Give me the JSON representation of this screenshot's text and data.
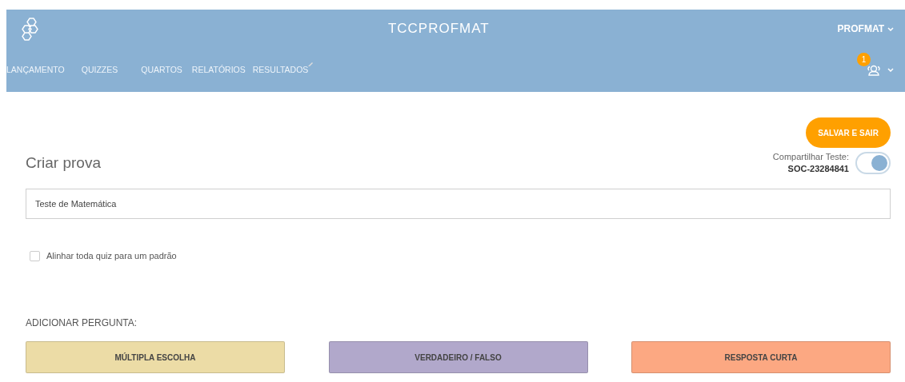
{
  "header": {
    "title": "TCCPROFMAT",
    "user_menu": "PROFMAT",
    "notification_count": "1",
    "nav": [
      {
        "label": "LANÇAMENTO",
        "selected": false
      },
      {
        "label": "QUIZZES",
        "selected": false
      },
      {
        "label": "QUARTOS",
        "selected": false
      },
      {
        "label": "RELATÓRIOS",
        "selected": false
      },
      {
        "label": "RESULTADOS",
        "selected": false
      }
    ]
  },
  "save_button": "SALVAR E SAIR",
  "heading": "Criar prova",
  "share": {
    "label": "Compartilhar Teste:",
    "code": "SOC-23284841",
    "on": true
  },
  "title_field": {
    "value": "Teste de Matemática"
  },
  "align_checkbox": {
    "label": "Alinhar toda quiz para um padrão",
    "checked": false
  },
  "add_question": {
    "label": "ADICIONAR PERGUNTA:",
    "types": [
      {
        "label": "MÚLTIPLA ESCOLHA",
        "color": "#ecdca6"
      },
      {
        "label": "VERDADEIRO / FALSO",
        "color": "#b1a8cb"
      },
      {
        "label": "RESPOSTA CURTA",
        "color": "#fca882"
      }
    ]
  }
}
